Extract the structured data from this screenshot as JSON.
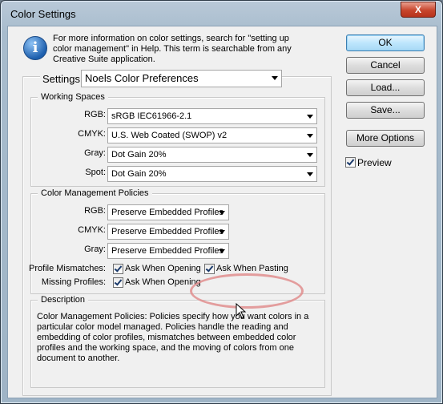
{
  "window": {
    "title": "Color Settings",
    "close_glyph": "X"
  },
  "info": {
    "icon": "info-icon",
    "icon_glyph": "i",
    "text": "For more information on color settings, search for \"setting up color management\" in Help. This term is searchable from any Creative Suite application."
  },
  "settings": {
    "label": "Settings:",
    "value": "Noels Color Preferences"
  },
  "working_spaces": {
    "title": "Working Spaces",
    "rows": [
      {
        "label": "RGB:",
        "value": "sRGB IEC61966-2.1"
      },
      {
        "label": "CMYK:",
        "value": "U.S. Web Coated (SWOP) v2"
      },
      {
        "label": "Gray:",
        "value": "Dot Gain 20%"
      },
      {
        "label": "Spot:",
        "value": "Dot Gain 20%"
      }
    ]
  },
  "policies": {
    "title": "Color Management Policies",
    "rows": [
      {
        "label": "RGB:",
        "value": "Preserve Embedded Profiles"
      },
      {
        "label": "CMYK:",
        "value": "Preserve Embedded Profiles"
      },
      {
        "label": "Gray:",
        "value": "Preserve Embedded Profiles"
      }
    ],
    "profile_mismatches": {
      "label": "Profile Mismatches:",
      "ask_when_opening": {
        "label": "Ask When Opening",
        "checked": true
      },
      "ask_when_pasting": {
        "label": "Ask When Pasting",
        "checked": true
      }
    },
    "missing_profiles": {
      "label": "Missing Profiles:",
      "ask_when_opening": {
        "label": "Ask When Opening",
        "checked": true
      }
    }
  },
  "description": {
    "title": "Description",
    "text": "Color Management Policies:  Policies specify how you want colors in a particular color model managed.  Policies handle the reading and embedding of color profiles, mismatches between embedded color profiles and the working space, and the moving of colors from one document to another."
  },
  "buttons": {
    "ok": "OK",
    "cancel": "Cancel",
    "load": "Load...",
    "save": "Save...",
    "more_options": "More Options"
  },
  "preview": {
    "label": "Preview",
    "checked": true
  },
  "colors": {
    "highlight": "#e08e8e",
    "default_button": "#bee6fd",
    "title_bar": "#b9c9d8"
  }
}
